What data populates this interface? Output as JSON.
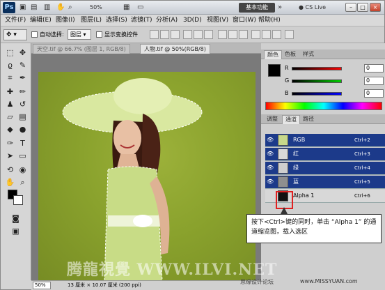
{
  "titlebar": {
    "zoom": "50%",
    "workspace_label": "基本功能",
    "cslive": "CS Live",
    "min": "–",
    "max": "□",
    "close": "×"
  },
  "menu": [
    "文件(F)",
    "编辑(E)",
    "图像(I)",
    "图层(L)",
    "选择(S)",
    "滤镜(T)",
    "分析(A)",
    "3D(D)",
    "视图(V)",
    "窗口(W)",
    "帮助(H)"
  ],
  "options": {
    "auto_select_label": "自动选择:",
    "auto_select_value": "图层",
    "show_transform_label": "显示变换控件"
  },
  "tabs": {
    "inactive": "天空.tif @ 66.7% (图层 1, RGB/8)",
    "active": "人物.tif @ 50%(RGB/8)"
  },
  "status": {
    "zoom": "50%",
    "doc_info": "13 厘米 × 10.07 厘米 (200 ppi)"
  },
  "color_panel": {
    "tabs": [
      "颜色",
      "色板",
      "样式"
    ],
    "sliders": [
      {
        "label": "R",
        "value": "0",
        "color": "#d11"
      },
      {
        "label": "G",
        "value": "0",
        "color": "#1a1"
      },
      {
        "label": "B",
        "value": "0",
        "color": "#11c"
      }
    ]
  },
  "channel_panel": {
    "tabs": [
      "调整",
      "通道",
      "路径"
    ],
    "channels": [
      {
        "name": "RGB",
        "key": "Ctrl+2",
        "selected": true
      },
      {
        "name": "红",
        "key": "Ctrl+3",
        "selected": true
      },
      {
        "name": "绿",
        "key": "Ctrl+4",
        "selected": true
      },
      {
        "name": "蓝",
        "key": "Ctrl+5",
        "selected": true
      },
      {
        "name": "Alpha 1",
        "key": "Ctrl+6",
        "selected": false
      }
    ]
  },
  "callout": {
    "text": "按下<Ctrl>键的同时，单击 “Alpha 1” 的通道缩览图，载入选区"
  },
  "watermarks": {
    "main": "腾龍視覺 WWW.ILVI.NET",
    "brand": "思缘设计论坛",
    "url": "www.MISSYUAN.com"
  }
}
